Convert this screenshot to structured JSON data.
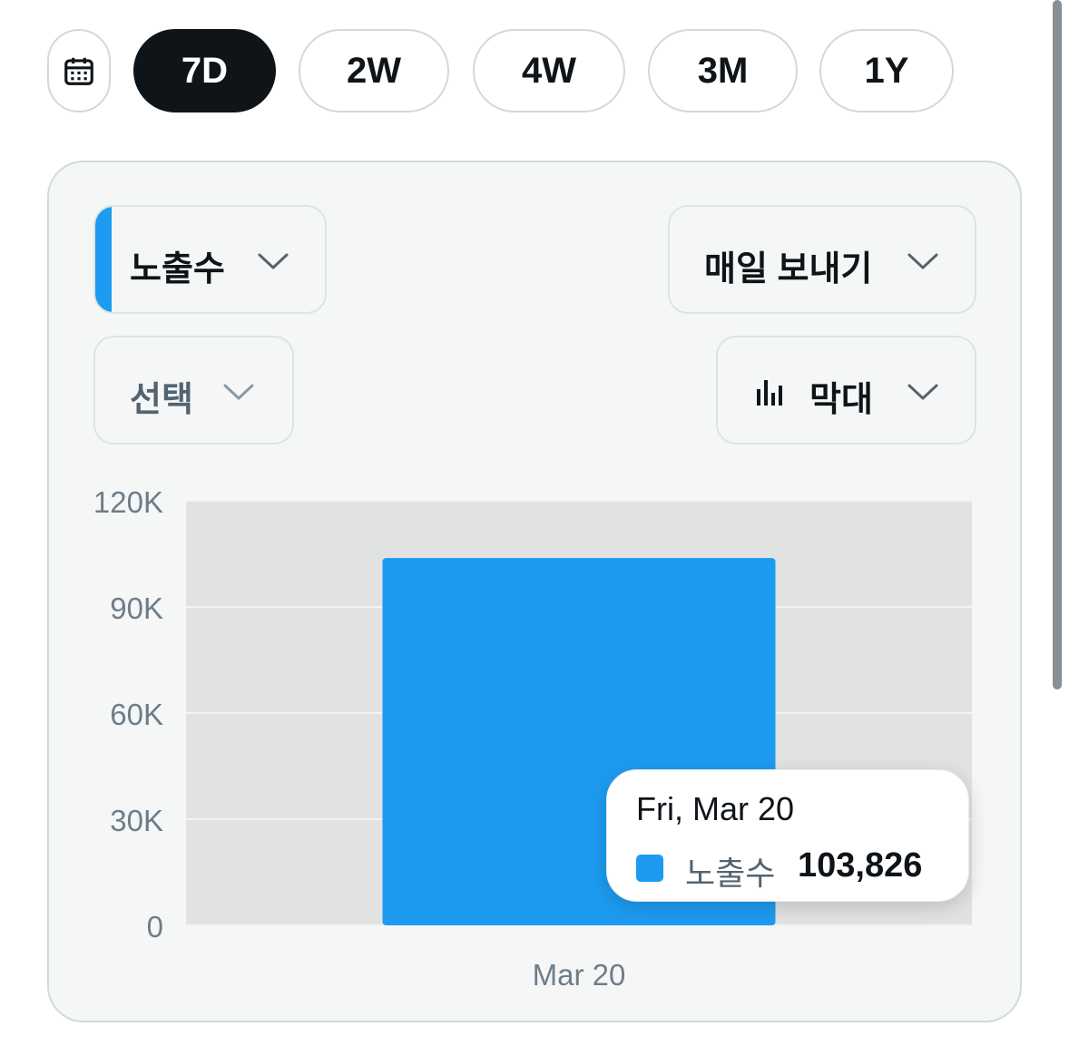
{
  "range_tabs": {
    "items": [
      {
        "label": "7D",
        "active": true
      },
      {
        "label": "2W",
        "active": false
      },
      {
        "label": "4W",
        "active": false
      },
      {
        "label": "3M",
        "active": false
      },
      {
        "label": "1Y",
        "active": false
      }
    ]
  },
  "icons": {
    "calendar": "calendar-icon",
    "chevron": "chevron-down-icon",
    "bar_chart": "bar-chart-icon"
  },
  "controls": {
    "metric": "노출수",
    "export": "매일 보내기",
    "compare": "선택",
    "chart_type": "막대"
  },
  "colors": {
    "accent": "#1d9bf0",
    "active_tab": "#0f1419",
    "plot_background": "#e1e3e3"
  },
  "chart_data": {
    "type": "bar",
    "categories": [
      "Mar 20"
    ],
    "series": [
      {
        "name": "노출수",
        "values": [
          103826
        ]
      }
    ],
    "ylim": [
      0,
      120000
    ],
    "yticks": [
      0,
      30000,
      60000,
      90000,
      120000
    ],
    "ytick_labels": [
      "0",
      "30K",
      "60K",
      "90K",
      "120K"
    ],
    "grid": true
  },
  "tooltip": {
    "date": "Fri, Mar 20",
    "series": "노출수",
    "value": "103,826"
  }
}
